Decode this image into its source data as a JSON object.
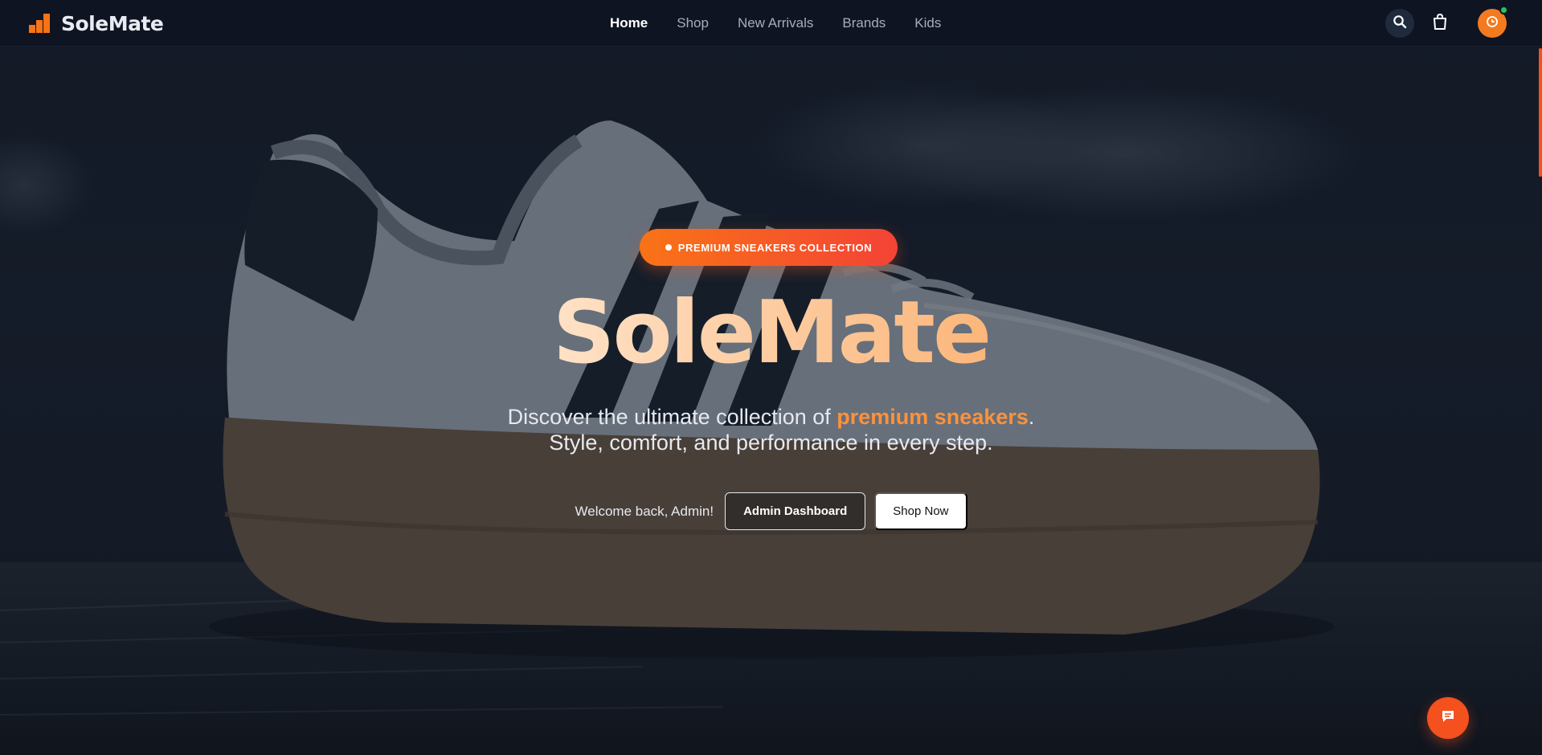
{
  "brand": {
    "name": "SoleMate",
    "accent_color": "#f97316",
    "logo_icon": "stairs-bars-icon"
  },
  "nav": {
    "items": [
      {
        "label": "Home",
        "active": true
      },
      {
        "label": "Shop",
        "active": false
      },
      {
        "label": "New Arrivals",
        "active": false
      },
      {
        "label": "Brands",
        "active": false
      },
      {
        "label": "Kids",
        "active": false
      }
    ],
    "icons": {
      "search": "search-icon",
      "cart": "shopping-bag-icon",
      "avatar": "user-avatar-icon",
      "status": "online"
    }
  },
  "hero": {
    "badge": "PREMIUM SNEAKERS COLLECTION",
    "title": "SoleMate",
    "subtitle_prefix": "Discover the ultimate collection of ",
    "subtitle_highlight": "premium sneakers",
    "subtitle_suffix": ".",
    "subtitle_line2": "Style, comfort, and performance in every step.",
    "welcome": "Welcome back, Admin!",
    "buttons": {
      "dashboard": "Admin Dashboard",
      "shop_now": "Shop Now"
    },
    "background_image": "white sneaker with black stripes and gum sole"
  },
  "chat": {
    "icon": "chat-bubble-icon"
  }
}
